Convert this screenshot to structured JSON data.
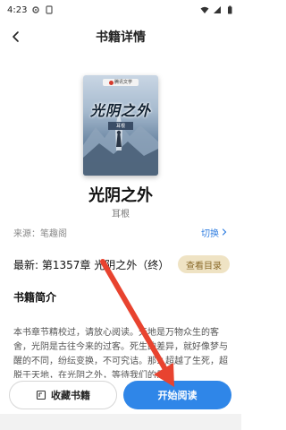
{
  "status_bar": {
    "time": "4:23"
  },
  "header": {
    "title": "书籍详情"
  },
  "cover": {
    "badge_text": "腾讯文学",
    "title": "光阴之外",
    "author_tag": "耳根"
  },
  "book": {
    "name": "光阴之外",
    "author": "耳根"
  },
  "source": {
    "label": "来源：笔趣阁",
    "switch_label": "切换"
  },
  "latest": {
    "text": "最新: 第1357章 光阴之外（终）",
    "toc_label": "查看目录"
  },
  "intro": {
    "heading": "书籍简介",
    "text": "本书章节精校过，请放心阅读。天地是万物众生的客舍，光阴是古往今来的过客。死生的差异，就好像梦与醒的不同，纷纭变换，不可究诘。那么超越了生死，超脱于天地，在光阴之外，等待我们的是"
  },
  "actions": {
    "favorite_label": "收藏书籍",
    "read_label": "开始阅读"
  },
  "colors": {
    "accent": "#2f86e8",
    "link": "#2f7de0",
    "toc_bg": "#efe3c4",
    "arrow": "#e8432f"
  }
}
